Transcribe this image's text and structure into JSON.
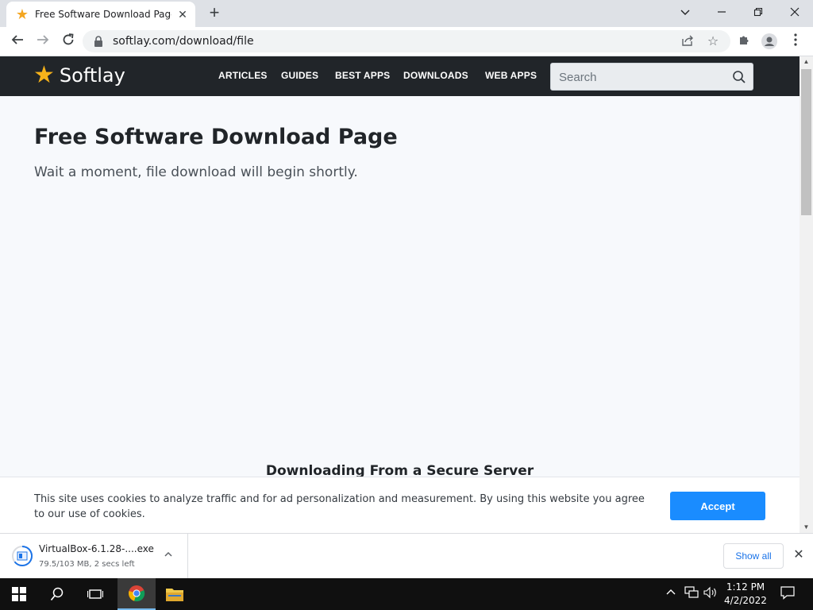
{
  "browser": {
    "tab_title": "Free Software Download Page - S",
    "url": "softlay.com/download/file"
  },
  "site": {
    "logo_text": "Softlay",
    "nav": [
      "ARTICLES",
      "GUIDES",
      "BEST APPS",
      "DOWNLOADS",
      "WEB APPS"
    ],
    "search_placeholder": "Search"
  },
  "main": {
    "title": "Free Software Download Page",
    "subtitle": "Wait a moment, file download will begin shortly.",
    "secure_heading": "Downloading From a Secure Server"
  },
  "cookie": {
    "text": "This site uses cookies to analyze traffic and for ad personalization and measurement. By using this website you agree to our use of cookies.",
    "accept_label": "Accept"
  },
  "download": {
    "file_name": "VirtualBox-6.1.28-....exe",
    "status": "79.5/103 MB, 2 secs left",
    "show_all_label": "Show all"
  },
  "taskbar": {
    "time": "1:12 PM",
    "date": "4/2/2022"
  },
  "colors": {
    "site_header": "#212529",
    "accent": "#1a8cff",
    "logo_star": "#f6b21a"
  }
}
